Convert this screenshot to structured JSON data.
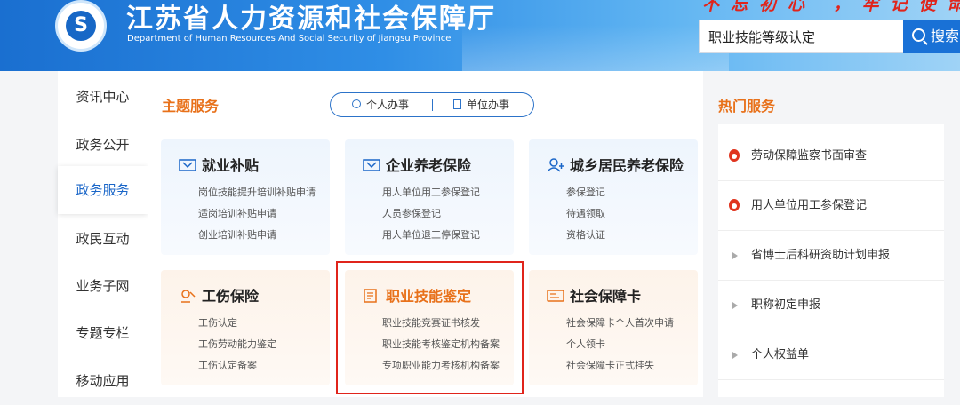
{
  "header": {
    "title": "江苏省人力资源和社会保障厅",
    "subtitle": "Department of Human Resources And Social Security of Jiangsu Province",
    "slogan": "不忘初心 ，牢记使命",
    "search_value": "职业技能等级认定",
    "search_button": "搜索"
  },
  "sidebar": {
    "items": [
      {
        "label": "资讯中心"
      },
      {
        "label": "政务公开"
      },
      {
        "label": "政务服务"
      },
      {
        "label": "政民互动"
      },
      {
        "label": "业务子网"
      },
      {
        "label": "专题专栏"
      },
      {
        "label": "移动应用"
      }
    ],
    "active": "政务服务"
  },
  "main": {
    "section_title": "主题服务",
    "toggle": {
      "personal": "个人办事",
      "unit": "单位办事"
    },
    "cards": [
      {
        "title": "就业补贴",
        "icon": "subsidy-icon",
        "links": [
          "岗位技能提升培训补贴申请",
          "适岗培训补贴申请",
          "创业培训补贴申请"
        ]
      },
      {
        "title": "企业养老保险",
        "icon": "pension-icon",
        "links": [
          "用人单位用工参保登记",
          "人员参保登记",
          "用人单位退工停保登记"
        ]
      },
      {
        "title": "城乡居民养老保险",
        "icon": "resident-icon",
        "links": [
          "参保登记",
          "待遇领取",
          "资格认证"
        ]
      },
      {
        "title": "工伤保险",
        "icon": "injury-icon",
        "links": [
          "工伤认定",
          "工伤劳动能力鉴定",
          "工伤认定备案"
        ]
      },
      {
        "title": "职业技能鉴定",
        "icon": "skill-icon",
        "links": [
          "职业技能竞赛证书核发",
          "职业技能考核鉴定机构备案",
          "专项职业能力考核机构备案"
        ]
      },
      {
        "title": "社会保障卡",
        "icon": "card-icon",
        "links": [
          "社会保障卡个人首次申请",
          "个人领卡",
          "社会保障卡正式挂失"
        ]
      }
    ]
  },
  "hot": {
    "title": "热门服务",
    "items": [
      {
        "label": "劳动保障监察书面审查",
        "hot": true
      },
      {
        "label": "用人单位用工参保登记",
        "hot": true
      },
      {
        "label": "省博士后科研资助计划申报",
        "hot": false
      },
      {
        "label": "职称初定申报",
        "hot": false
      },
      {
        "label": "个人权益单",
        "hot": false
      }
    ]
  },
  "colors": {
    "brand": "#1a66c8",
    "accent": "#e8711a",
    "highlight": "#e0241b"
  }
}
